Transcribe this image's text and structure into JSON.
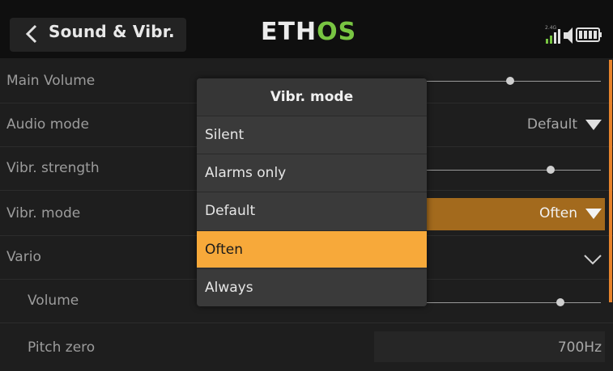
{
  "header": {
    "title": "Sound & Vibr.",
    "logo_main": "ETH",
    "logo_accent": "OS",
    "signal_label": "2.4G"
  },
  "settings": {
    "main_volume": {
      "label": "Main Volume",
      "level": 0.6
    },
    "audio_mode": {
      "label": "Audio mode",
      "value": "Default"
    },
    "vibr_strength": {
      "label": "Vibr. strength",
      "level": 0.78
    },
    "vibr_mode": {
      "label": "Vibr. mode",
      "value": "Often"
    },
    "vario": {
      "label": "Vario"
    },
    "vario_volume": {
      "label": "Volume",
      "level": 0.82
    },
    "pitch_zero": {
      "label": "Pitch zero",
      "value": "700Hz"
    }
  },
  "modal": {
    "title": "Vibr. mode",
    "options": [
      "Silent",
      "Alarms only",
      "Default",
      "Often",
      "Always"
    ],
    "selected": "Often"
  },
  "colors": {
    "accent": "#f7a93a",
    "logo_green": "#78c542",
    "scrollbar": "#e8842c"
  }
}
